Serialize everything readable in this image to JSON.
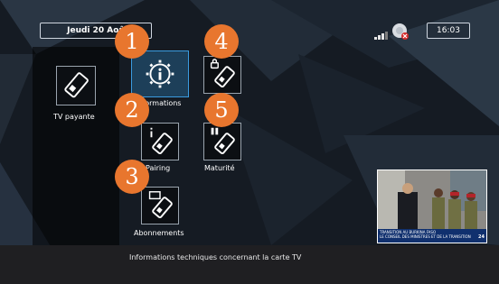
{
  "header": {
    "date": "Jeudi 20 Aoû",
    "time": "16:03"
  },
  "menu": {
    "tv_payante": "TV payante",
    "informations": "Informations",
    "pairing": "Pairing",
    "abonnements": "Abonnements",
    "maturite": "Maturité"
  },
  "badges": [
    "1",
    "2",
    "3",
    "4",
    "5"
  ],
  "footer": {
    "description": "Informations techniques concernant la carte TV"
  },
  "pip": {
    "ticker_line1": "TRANSITION AU BURKINA FASO",
    "ticker_line2": "LE CONSEIL DES MINISTRES ET DE LA TRANSITION",
    "channel": "24"
  },
  "colors": {
    "badge": "#e8762e",
    "focus_tile": "#1d3f59",
    "footer": "#1f1f22"
  },
  "icons": [
    "smartcard-icon",
    "gear-info-icon",
    "signal-icon",
    "satellite-icon"
  ]
}
